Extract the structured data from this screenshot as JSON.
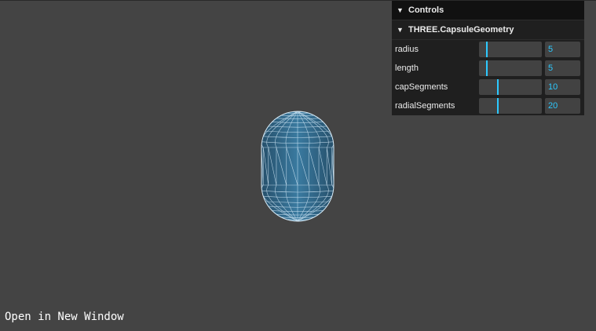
{
  "gui": {
    "title": "Controls",
    "folder_title": "THREE.CapsuleGeometry",
    "params": [
      {
        "label": "radius",
        "value": "5",
        "fraction": 0.12
      },
      {
        "label": "length",
        "value": "5",
        "fraction": 0.12
      },
      {
        "label": "capSegments",
        "value": "10",
        "fraction": 0.3
      },
      {
        "label": "radialSegments",
        "value": "20",
        "fraction": 0.3
      }
    ]
  },
  "footer": {
    "open_link": "Open in New Window"
  },
  "colors": {
    "background": "#444444",
    "mesh_fill": "#2e5f7d",
    "wireframe": "#cfe6f5",
    "accent": "#2cc9ff"
  },
  "icons": {
    "collapse": "chevron-down-icon"
  }
}
